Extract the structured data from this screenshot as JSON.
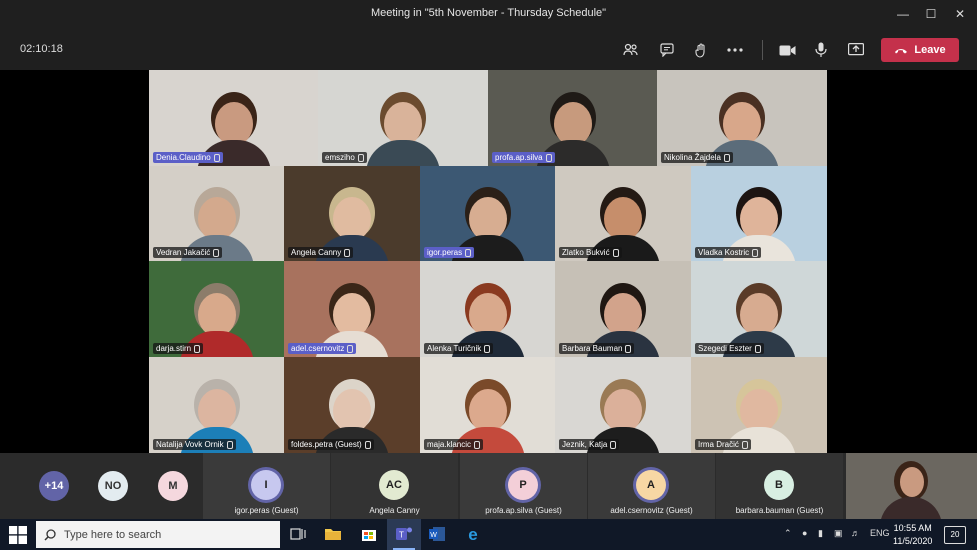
{
  "window": {
    "title": "Meeting in \"5th November - Thursday Schedule\""
  },
  "toolbar": {
    "timer": "02:10:18",
    "leave_label": "Leave"
  },
  "participants": [
    {
      "name": "Denia.Claudino",
      "bg": "#d8d4cf",
      "skin": "#c99a80",
      "shirt": "#3a2a2a",
      "hair": "#3a2418",
      "hl": true
    },
    {
      "name": "emsziho",
      "bg": "#d6d6d2",
      "skin": "#d9b39a",
      "shirt": "#3a4a55",
      "hair": "#6b4b2f",
      "hl": false
    },
    {
      "name": "profa.ap.silva",
      "bg": "#5a5a52",
      "skin": "#c79a7d",
      "shirt": "#2c2b2a",
      "hair": "#1f1a16",
      "hl": true
    },
    {
      "name": "Nikolina Žajdela",
      "bg": "#c8c4bd",
      "skin": "#d8a78a",
      "shirt": "#5b6c7a",
      "hair": "#4a3022",
      "hl": false
    },
    {
      "name": "Vedran Jakačić",
      "bg": "#d4cfc7",
      "skin": "#d3a98d",
      "shirt": "#6b7a88",
      "hair": "#b8a898",
      "hl": false
    },
    {
      "name": "Angela Canny",
      "bg": "#4b3b2c",
      "skin": "#e0bba0",
      "shirt": "#2a3a50",
      "hair": "#c8b78e",
      "hl": false
    },
    {
      "name": "igor.peras",
      "bg": "#3c5873",
      "skin": "#d7ad91",
      "shirt": "#1c1c1c",
      "hair": "#2b2018",
      "hl": true
    },
    {
      "name": "Zlatko Bukvić",
      "bg": "#cfc9c0",
      "skin": "#c68e6b",
      "shirt": "#1a1a1a",
      "hair": "#241a14",
      "hl": false
    },
    {
      "name": "Vladka Kostric",
      "bg": "#b9d0e0",
      "skin": "#dfb49a",
      "shirt": "#e9e4dc",
      "hair": "#1c1412",
      "hl": false
    },
    {
      "name": "darja.stirn",
      "bg": "#3f6b3b",
      "skin": "#d8a98b",
      "shirt": "#b02a2a",
      "hair": "#8c7c6a",
      "hl": false
    },
    {
      "name": "adel.csernovitz",
      "bg": "#a8725e",
      "skin": "#e3bba0",
      "shirt": "#e6ddd3",
      "hair": "#3a2618",
      "hl": true
    },
    {
      "name": "Alenka Turičnik",
      "bg": "#d7d6d2",
      "skin": "#d9a98c",
      "shirt": "#1f2a38",
      "hair": "#8a3a20",
      "hl": false
    },
    {
      "name": "Barbara Bauman",
      "bg": "#c6c0b6",
      "skin": "#d2a38b",
      "shirt": "#2a3340",
      "hair": "#1f1712",
      "hl": false
    },
    {
      "name": "Szegedi Eszter",
      "bg": "#cfd7d8",
      "skin": "#d7ab90",
      "shirt": "#2d3a48",
      "hair": "#5a3b28",
      "hl": false
    },
    {
      "name": "Natalija Vovk Ornik",
      "bg": "#d6d1c9",
      "skin": "#dcb5a0",
      "shirt": "#1c7fb8",
      "hair": "#b9b2aa",
      "hl": false
    },
    {
      "name": "foldes.petra (Guest)",
      "bg": "#5b3e2a",
      "skin": "#e2c4b0",
      "shirt": "#2a2a2a",
      "hair": "#dcd4c9",
      "hl": false
    },
    {
      "name": "maja.klancic",
      "bg": "#e1ddd6",
      "skin": "#dca98d",
      "shirt": "#c44a3c",
      "hair": "#7a4a2a",
      "hl": false
    },
    {
      "name": "Jeznik, Katja",
      "bg": "#d9d7d3",
      "skin": "#dbb09a",
      "shirt": "#1d1d1d",
      "hair": "#9a7a55",
      "hl": false
    },
    {
      "name": "Irma Dračić",
      "bg": "#cdc3b4",
      "skin": "#e0b8a0",
      "shirt": "#e8e2d8",
      "hair": "#d6c59a",
      "hl": false
    }
  ],
  "overflow": [
    {
      "initials": "+14",
      "bg": "#6264a7",
      "fg": "#ffffff"
    },
    {
      "initials": "NO",
      "bg": "#e3ecf0",
      "fg": "#333333"
    },
    {
      "initials": "M",
      "bg": "#f5d8de",
      "fg": "#333333"
    }
  ],
  "strip": [
    {
      "initials": "I",
      "name": "igor.peras (Guest)",
      "bg": "#c7c8ef",
      "ring": true
    },
    {
      "initials": "AC",
      "name": "Angela Canny",
      "bg": "#e2ead1",
      "ring": false
    },
    {
      "initials": "P",
      "name": "profa.ap.silva (Guest)",
      "bg": "#f3cfd8",
      "ring": true
    },
    {
      "initials": "A",
      "name": "adel.csernovitz (Guest)",
      "bg": "#f7d7a4",
      "ring": true
    },
    {
      "initials": "B",
      "name": "barbara.bauman (Guest)",
      "bg": "#d8efe2",
      "ring": false
    }
  ],
  "taskbar": {
    "search_placeholder": "Type here to search",
    "lang": "ENG",
    "time": "10:55 AM",
    "date": "11/5/2020",
    "notifications": "20"
  }
}
